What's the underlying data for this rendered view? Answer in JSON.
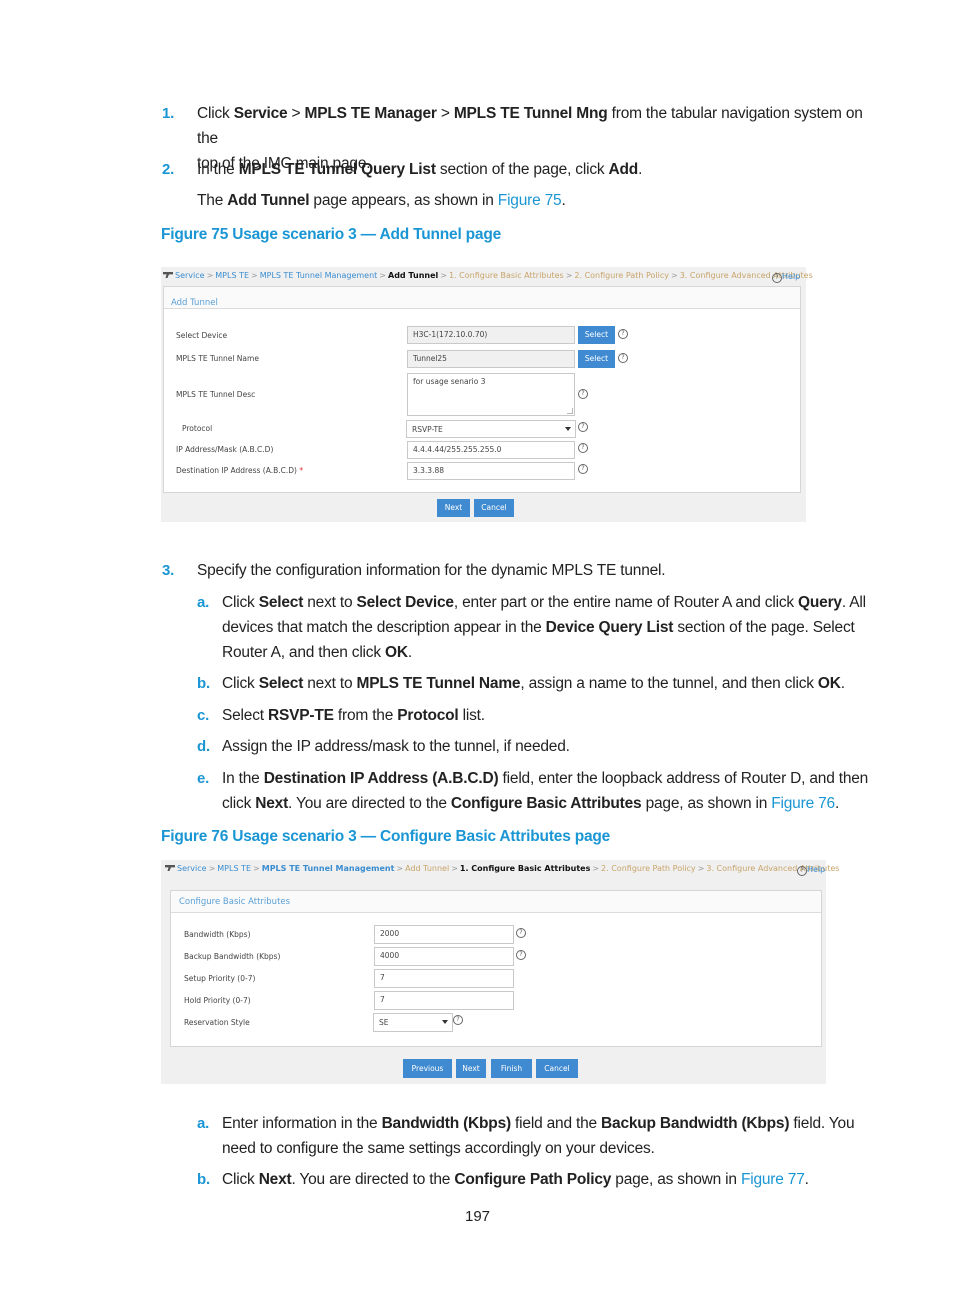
{
  "steps": {
    "step1": {
      "num": "1.",
      "t1": "Click ",
      "b1": "Service",
      "t2": " > ",
      "b2": "MPLS TE Manager",
      "t3": " > ",
      "b3": "MPLS TE Tunnel Mng",
      "t4": " from the tabular navigation system on the",
      "line2": "top of the IMC main page."
    },
    "step2": {
      "num": "2.",
      "t1": "In the ",
      "b1": "MPLS TE Tunnel Query List",
      "t2": " section of the page, click ",
      "b2": "Add",
      "t3": ".",
      "sub_t1": "The ",
      "sub_b1": "Add Tunnel",
      "sub_t2": " page appears, as shown in ",
      "sub_link": "Figure 75",
      "sub_t3": "."
    },
    "step3": {
      "num": "3.",
      "text": "Specify the configuration information for the dynamic MPLS TE tunnel.",
      "a": {
        "num": "a.",
        "t1": "Click ",
        "b1": "Select",
        "t2": " next to ",
        "b2": "Select Device",
        "t3": ", enter part or the entire name of Router A and click ",
        "b3": "Query",
        "t4": ". All",
        "l2_t1": "devices that match the description appear in the ",
        "l2_b1": "Device Query List",
        "l2_t2": " section of the page. Select",
        "l3_t1": "Router A, and then click ",
        "l3_b1": "OK",
        "l3_t2": "."
      },
      "b": {
        "num": "b.",
        "t1": "Click ",
        "b1": "Select",
        "t2": " next to ",
        "b2": "MPLS TE Tunnel Name",
        "t3": ", assign a name to the tunnel, and then click ",
        "b3": "OK",
        "t4": "."
      },
      "c": {
        "num": "c.",
        "t1": "Select ",
        "b1": "RSVP-TE",
        "t2": " from the ",
        "b2": "Protocol",
        "t3": " list."
      },
      "d": {
        "num": "d.",
        "text": "Assign the IP address/mask to the tunnel, if needed."
      },
      "e": {
        "num": "e.",
        "t1": "In the ",
        "b1": "Destination IP Address (A.B.C.D)",
        "t2": " field, enter the loopback address of Router D, and then",
        "l2_t1": "click ",
        "l2_b1": "Next",
        "l2_t2": ". You are directed to the ",
        "l2_b2": "Configure Basic Attributes",
        "l2_t3": " page, as shown in ",
        "l2_link": "Figure 76",
        "l2_t4": "."
      }
    },
    "step4": {
      "a": {
        "num": "a.",
        "t1": "Enter information in the ",
        "b1": "Bandwidth (Kbps)",
        "t2": " field and the ",
        "b2": "Backup Bandwidth (Kbps)",
        "t3": " field. You",
        "line2": "need to configure the same settings accordingly on your devices."
      },
      "b": {
        "num": "b.",
        "t1": "Click ",
        "b1": "Next",
        "t2": ". You are directed to the ",
        "b2": "Configure Path Policy",
        "t3": " page, as shown in ",
        "link": "Figure 77",
        "t4": "."
      }
    }
  },
  "figure75": {
    "caption": "Figure 75 Usage scenario 3 — Add Tunnel page",
    "breadcrumb": {
      "service": "Service",
      "mpls_te": "MPLS TE",
      "tunnel_mgmt": "MPLS TE Tunnel Management",
      "current": "Add Tunnel",
      "step1": "1. Configure Basic Attributes",
      "step2": "2. Configure Path Policy",
      "step3": "3. Configure Advanced Attributes",
      "separator": ">"
    },
    "help_label": "Help",
    "panel_title": "Add Tunnel",
    "fields": {
      "select_device": {
        "label": "Select Device",
        "value": "H3C-1(172.10.0.70)",
        "button": "Select"
      },
      "tunnel_name": {
        "label": "MPLS TE Tunnel Name",
        "value": "Tunnel25",
        "button": "Select"
      },
      "tunnel_desc": {
        "label": "MPLS TE Tunnel Desc",
        "value": "for usage senario 3"
      },
      "protocol": {
        "label": "Protocol",
        "value": "RSVP-TE"
      },
      "ip_mask": {
        "label": "IP Address/Mask (A.B.C.D)",
        "value": "4.4.4.44/255.255.255.0"
      },
      "dest_ip": {
        "label": "Destination IP Address (A.B.C.D)",
        "required_mark": "*",
        "value": "3.3.3.88"
      }
    },
    "buttons": {
      "next": "Next",
      "cancel": "Cancel"
    }
  },
  "figure76": {
    "caption": "Figure 76 Usage scenario 3 — Configure Basic Attributes page",
    "breadcrumb": {
      "service": "Service",
      "mpls_te": "MPLS TE",
      "tunnel_mgmt": "MPLS TE Tunnel Management",
      "add_tunnel": "Add Tunnel",
      "step1": "1. Configure Basic Attributes",
      "step2": "2. Configure Path Policy",
      "step3": "3. Configure Advanced Attributes",
      "separator": ">"
    },
    "help_label": "Help",
    "panel_title": "Configure Basic Attributes",
    "fields": {
      "bandwidth": {
        "label": "Bandwidth (Kbps)",
        "value": "2000"
      },
      "backup_bandwidth": {
        "label": "Backup Bandwidth (Kbps)",
        "value": "4000"
      },
      "setup_priority": {
        "label": "Setup Priority (0-7)",
        "value": "7"
      },
      "hold_priority": {
        "label": "Hold Priority (0-7)",
        "value": "7"
      },
      "reservation_style": {
        "label": "Reservation Style",
        "value": "SE"
      }
    },
    "buttons": {
      "previous": "Previous",
      "next": "Next",
      "finish": "Finish",
      "cancel": "Cancel"
    }
  },
  "icons": {
    "help": "question-circle-icon",
    "service": "service-tool-icon",
    "dropdown": "caret-down-icon"
  },
  "colors": {
    "accent": "#1a96d4",
    "button": "#3f8ad0",
    "breadcrumb_link": "#3a8dd0",
    "breadcrumb_step": "#c8a46a",
    "required": "#e03030"
  },
  "page_number": "197"
}
